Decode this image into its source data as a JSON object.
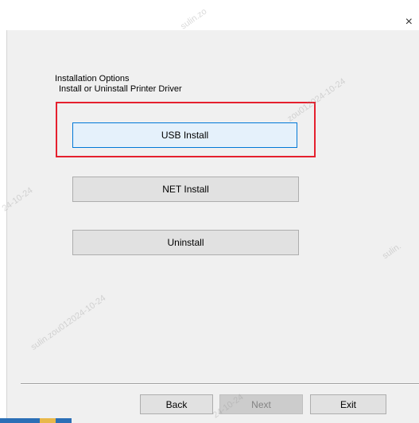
{
  "window": {
    "title_partial": "",
    "close_glyph": "×"
  },
  "dialog": {
    "heading": "Installation Options",
    "subheading": "Install or Uninstall Printer Driver"
  },
  "options": {
    "usb_label": "USB Install",
    "net_label": "NET Install",
    "uninstall_label": "Uninstall"
  },
  "footer": {
    "back_label": "Back",
    "next_label": "Next",
    "exit_label": "Exit"
  },
  "watermarks": [
    "sulin.zo",
    "zou012024-10-24",
    "24-10-24",
    "sulin.zou012024-10-24",
    "sulin.",
    "24-10-24"
  ],
  "colors": {
    "highlight": "#e5202e",
    "focus_border": "#0078d7",
    "button_bg": "#e1e1e1",
    "dialog_bg": "#f0f0f0"
  }
}
